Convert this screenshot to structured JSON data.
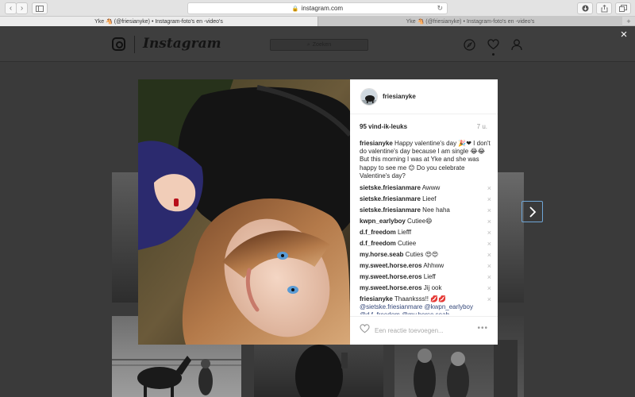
{
  "browser": {
    "url": "instagram.com",
    "tabs": [
      {
        "title": "Yke 🐴 (@friesianyke) • Instagram-foto's en -video's"
      },
      {
        "title": "Yke 🐴 (@friesianyke) • Instagram-foto's en -video's"
      }
    ],
    "new_tab": "+"
  },
  "instagram": {
    "wordmark": "Instagram",
    "search_placeholder": "Zoeken"
  },
  "modal": {
    "close": "×",
    "username": "friesianyke",
    "likes": "95 vind-ik-leuks",
    "time": "7 u.",
    "caption": {
      "user": "friesianyke",
      "text": "Happy valentine's day 🎉❤ I don't do valentine's day because I am single 😂😂 But this morning I was at Yke and she was happy to see me 😊 Do you celebrate Valentine's day?"
    },
    "comments": [
      {
        "user": "sietske.friesianmare",
        "text": "Awww"
      },
      {
        "user": "sietske.friesianmare",
        "text": "Lieef"
      },
      {
        "user": "sietske.friesianmare",
        "text": "Nee haha"
      },
      {
        "user": "kwpn_earlyboy",
        "text": "Cutiee😄"
      },
      {
        "user": "d.f_freedom",
        "text": "Liefff"
      },
      {
        "user": "d.f_freedom",
        "text": "Cutiee"
      },
      {
        "user": "my.horse.seab",
        "text": "Cuties 😍😍"
      },
      {
        "user": "my.sweet.horse.eros",
        "text": "Ahhww"
      },
      {
        "user": "my.sweet.horse.eros",
        "text": "Lieff"
      },
      {
        "user": "my.sweet.horse.eros",
        "text": "Jij ook"
      },
      {
        "user": "friesianyke",
        "text": "Thaanksss!! 💋💋",
        "mentions": "@sietske.friesianmare @kwpn_earlyboy @d.f_freedom @my.horse.seab"
      }
    ],
    "remove_icon": "×",
    "reply_placeholder": "Een reactie toevoegen...",
    "more": "•••"
  }
}
